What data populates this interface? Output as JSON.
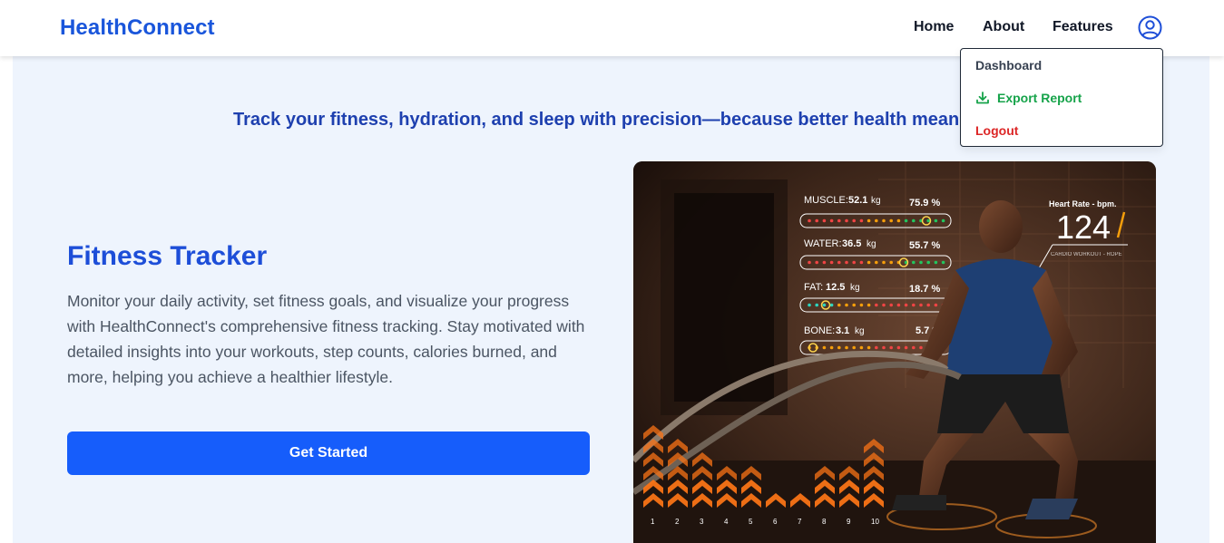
{
  "header": {
    "logo": "HealthConnect",
    "nav": [
      "Home",
      "About",
      "Features"
    ]
  },
  "dropdown": {
    "dashboard": "Dashboard",
    "export": "Export Report",
    "logout": "Logout"
  },
  "hero": {
    "tagline": "Track your fitness, hydration, and sleep with precision—because better health means bet",
    "title": "Fitness Tracker",
    "description": "Monitor your daily activity, set fitness goals, and visualize your progress with HealthConnect's comprehensive fitness tracking. Stay motivated with detailed insights into your workouts, step counts, calories burned, and more, helping you achieve a healthier lifestyle.",
    "cta": "Get Started"
  },
  "image_overlay": {
    "metrics": [
      {
        "label": "MUSCLE:",
        "value": "52.1",
        "unit": "kg",
        "pct": "75.9 %"
      },
      {
        "label": "WATER:",
        "value": "36.5",
        "unit": "kg",
        "pct": "55.7 %"
      },
      {
        "label": "FAT:",
        "value": "12.5",
        "unit": "kg",
        "pct": "18.7 %"
      },
      {
        "label": "BONE:",
        "value": "3.1",
        "unit": "kg",
        "pct": "5.7 %"
      }
    ],
    "heart_rate_label": "Heart Rate - bpm.",
    "heart_rate_value": "124",
    "heart_rate_sub": "CARDIO WORKOUT - ROPE",
    "bar_numbers": [
      "1",
      "2",
      "3",
      "4",
      "5",
      "6",
      "7",
      "8",
      "9",
      "10"
    ]
  },
  "colors": {
    "brand": "#1a56db",
    "cta": "#165dfb",
    "export": "#16a34a",
    "logout": "#dc2626",
    "background": "#eef4fd"
  }
}
